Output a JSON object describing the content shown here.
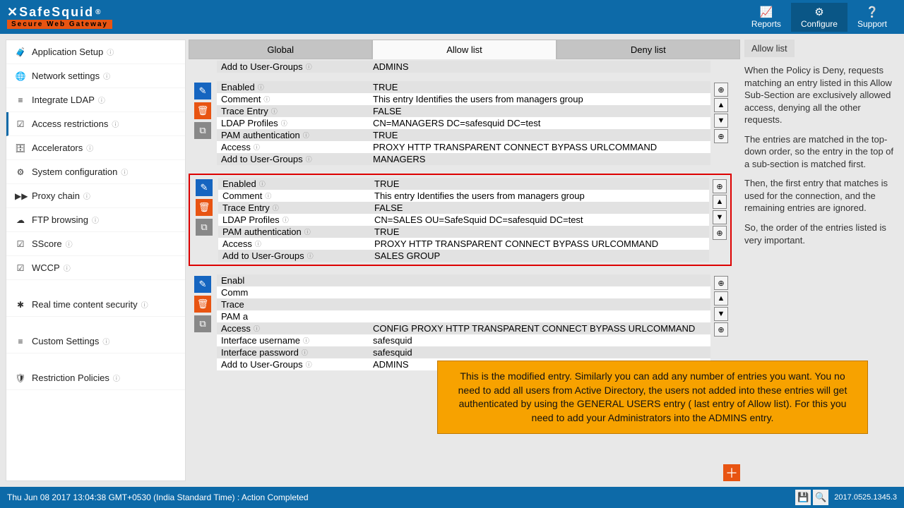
{
  "brand": {
    "name": "SafeSquid",
    "reg": "®",
    "tagline": "Secure Web Gateway"
  },
  "header_nav": {
    "reports": "Reports",
    "configure": "Configure",
    "support": "Support"
  },
  "sidebar": {
    "items": [
      {
        "icon": "🧳",
        "label": "Application Setup"
      },
      {
        "icon": "🌐",
        "label": "Network settings"
      },
      {
        "icon": "≡",
        "label": "Integrate LDAP"
      },
      {
        "icon": "☑",
        "label": "Access restrictions",
        "active": true
      },
      {
        "icon": "🗄",
        "label": "Accelerators"
      },
      {
        "icon": "⚙",
        "label": "System configuration"
      },
      {
        "icon": "▶▶",
        "label": "Proxy chain"
      },
      {
        "icon": "☁",
        "label": "FTP browsing"
      },
      {
        "icon": "☑",
        "label": "SScore"
      },
      {
        "icon": "☑",
        "label": "WCCP"
      }
    ],
    "group2": [
      {
        "icon": "✱",
        "label": "Real time content security"
      }
    ],
    "group3": [
      {
        "icon": "≡",
        "label": "Custom Settings"
      }
    ],
    "group4": [
      {
        "icon": "🛡",
        "label": "Restriction Policies"
      }
    ]
  },
  "tabs": {
    "global": "Global",
    "allow": "Allow list",
    "deny": "Deny list"
  },
  "field_labels": {
    "enabled": "Enabled",
    "comment": "Comment",
    "trace": "Trace Entry",
    "ldap": "LDAP Profiles",
    "pam": "PAM authentication",
    "access": "Access",
    "addgroups": "Add to User-Groups",
    "ifuser": "Interface username",
    "ifpass": "Interface password"
  },
  "entry0_tail": {
    "addgroups": "ADMINS"
  },
  "entry1": {
    "enabled": "TRUE",
    "comment": "This entry Identifies the users from managers group",
    "trace": "FALSE",
    "ldap": "CN=MANAGERS DC=safesquid DC=test",
    "pam": "TRUE",
    "access": "PROXY   HTTP   TRANSPARENT   CONNECT   BYPASS   URLCOMMAND",
    "addgroups": "MANAGERS"
  },
  "entry2": {
    "enabled": "TRUE",
    "comment": "This entry Identifies the users from managers group",
    "trace": "FALSE",
    "ldap": "CN=SALES OU=SafeSquid DC=safesquid DC=test",
    "pam": "TRUE",
    "access": "PROXY   HTTP   TRANSPARENT   CONNECT   BYPASS   URLCOMMAND",
    "addgroups": "SALES GROUP"
  },
  "entry3_partial": {
    "enabled_k": "Enabl",
    "comment_k": "Comm",
    "trace_k": "Trace",
    "pam_k": "PAM a",
    "access_k": "Access",
    "access": "CONFIG   PROXY   HTTP   TRANSPARENT   CONNECT   BYPASS   URLCOMMAND",
    "ifuser": "safesquid",
    "ifpass": "safesquid",
    "addgroups": "ADMINS"
  },
  "callout": "This is the modified entry. Similarly you can add any number of entries you want. You no need to add all users from Active Directory, the users not added into these entries will get authenticated by using the GENERAL USERS entry ( last entry of Allow list). For this you need to add your Administrators into the ADMINS entry.",
  "help": {
    "title": "Allow list",
    "p1": "When the Policy is Deny, requests matching an entry listed in this Allow Sub-Section are exclusively allowed access, denying all the other requests.",
    "p2": "The entries are matched in the top-down order, so the entry in the top of a sub-section is matched first.",
    "p3": "Then, the first entry that matches is used for the connection, and the remaining entries are ignored.",
    "p4": "So, the order of the entries listed is very important."
  },
  "footer": {
    "status": "Thu Jun 08 2017 13:04:38 GMT+0530 (India Standard Time) : Action Completed",
    "version": "2017.0525.1345.3"
  }
}
